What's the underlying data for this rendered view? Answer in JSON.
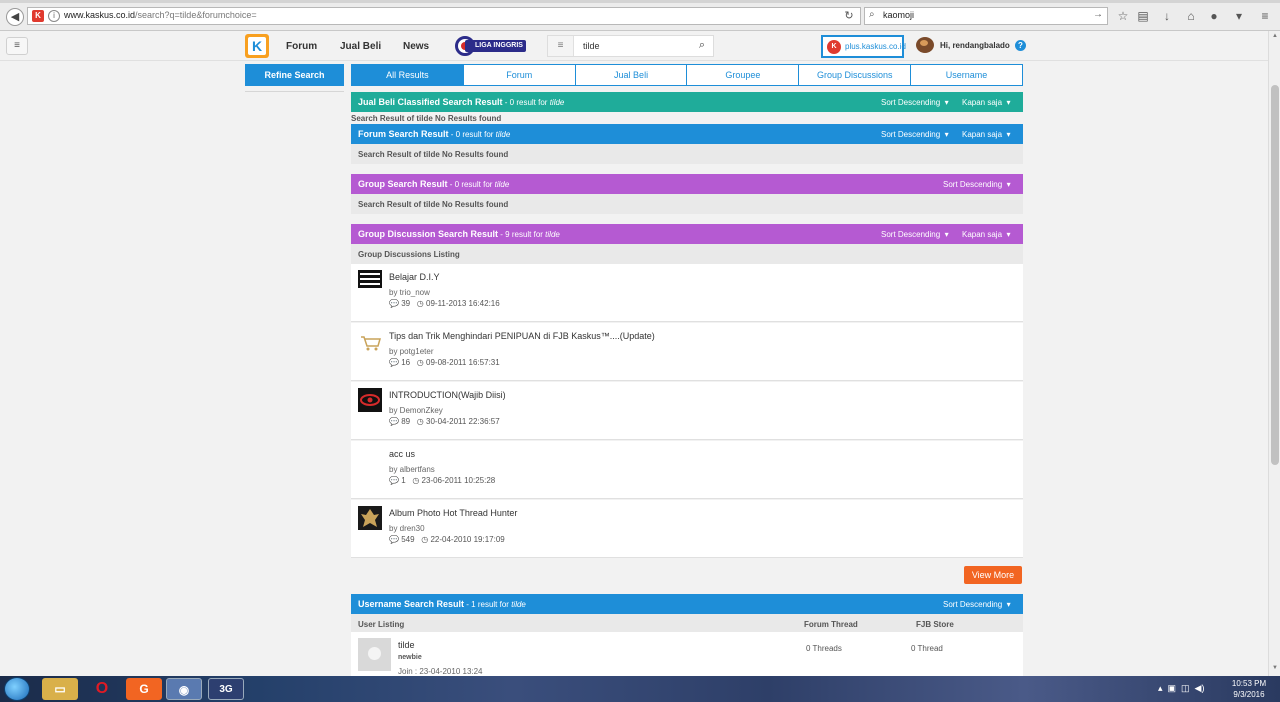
{
  "browser": {
    "url_host": "www.kaskus.co.id",
    "url_path": "/search?q=tilde&forumchoice=",
    "search_text": "kaomoji"
  },
  "header": {
    "nav": [
      "Forum",
      "Jual Beli",
      "News"
    ],
    "liga_label": "LIGA INGGRIS",
    "search_value": "tilde",
    "plus_label": "plus.kaskus.co.id",
    "greeting": "Hi, rendangbalado"
  },
  "sidebar": {
    "refine_label": "Refine Search"
  },
  "tabs": [
    "All Results",
    "Forum",
    "Jual Beli",
    "Groupee",
    "Group Discussions",
    "Username"
  ],
  "sections": {
    "jualbeli": {
      "title": "Jual Beli Classified Search Result",
      "count": " - 0 result for ",
      "query": "tilde",
      "sort": "Sort Descending",
      "time": "Kapan saja",
      "note": "Search Result of tilde No Results found"
    },
    "forum": {
      "title": "Forum Search Result",
      "count": " - 0 result for ",
      "query": "tilde",
      "sort": "Sort Descending",
      "time": "Kapan saja",
      "note": "Search Result of tilde No Results found"
    },
    "group": {
      "title": "Group Search Result",
      "count": " - 0 result for ",
      "query": "tilde",
      "sort": "Sort Descending",
      "note": "Search Result of tilde No Results found"
    },
    "discussion": {
      "title": "Group Discussion Search Result",
      "count": " - 9 result for ",
      "query": "tilde",
      "sort": "Sort Descending",
      "time": "Kapan saja",
      "listing": "Group Discussions Listing"
    },
    "username": {
      "title": "Username Search Result",
      "count": " - 1 result for ",
      "query": "tilde",
      "sort": "Sort Descending",
      "col_user": "User Listing",
      "col_forum": "Forum Thread",
      "col_store": "FJB Store"
    }
  },
  "discussions": [
    {
      "title": "Belajar D.I.Y",
      "by": "by trio_now",
      "replies": "39",
      "date": "09-11-2013 16:42:16",
      "thumb": "diy-logo"
    },
    {
      "title": "Tips dan Trik Menghindari PENIPUAN di FJB Kaskus™....(Update)",
      "by": "by potg1eter",
      "replies": "16",
      "date": "09-08-2011 16:57:31",
      "thumb": "cart-icon"
    },
    {
      "title": "INTRODUCTION(Wajib Diisi)",
      "by": "by DemonZkey",
      "replies": "89",
      "date": "30-04-2011 22:36:57",
      "thumb": "red-eye-logo"
    },
    {
      "title": "acc us",
      "by": "by albertfans",
      "replies": "1",
      "date": "23-06-2011 10:25:28",
      "thumb": "none"
    },
    {
      "title": "Album Photo Hot Thread Hunter",
      "by": "by dren30",
      "replies": "549",
      "date": "22-04-2010 19:17:09",
      "thumb": "gold-emblem"
    }
  ],
  "view_more": "View More",
  "user_result": {
    "name": "tilde",
    "rank": "newbie",
    "join": "Join : 23-04-2010 13:24",
    "threads": "0 Threads",
    "store": "0 Thread"
  },
  "taskbar": {
    "time": "10:53 PM",
    "date": "9/3/2016"
  },
  "colors": {
    "teal": "#1fac9a",
    "blue": "#1e8ed8",
    "purple": "#b55ad2",
    "orange": "#f26522"
  }
}
